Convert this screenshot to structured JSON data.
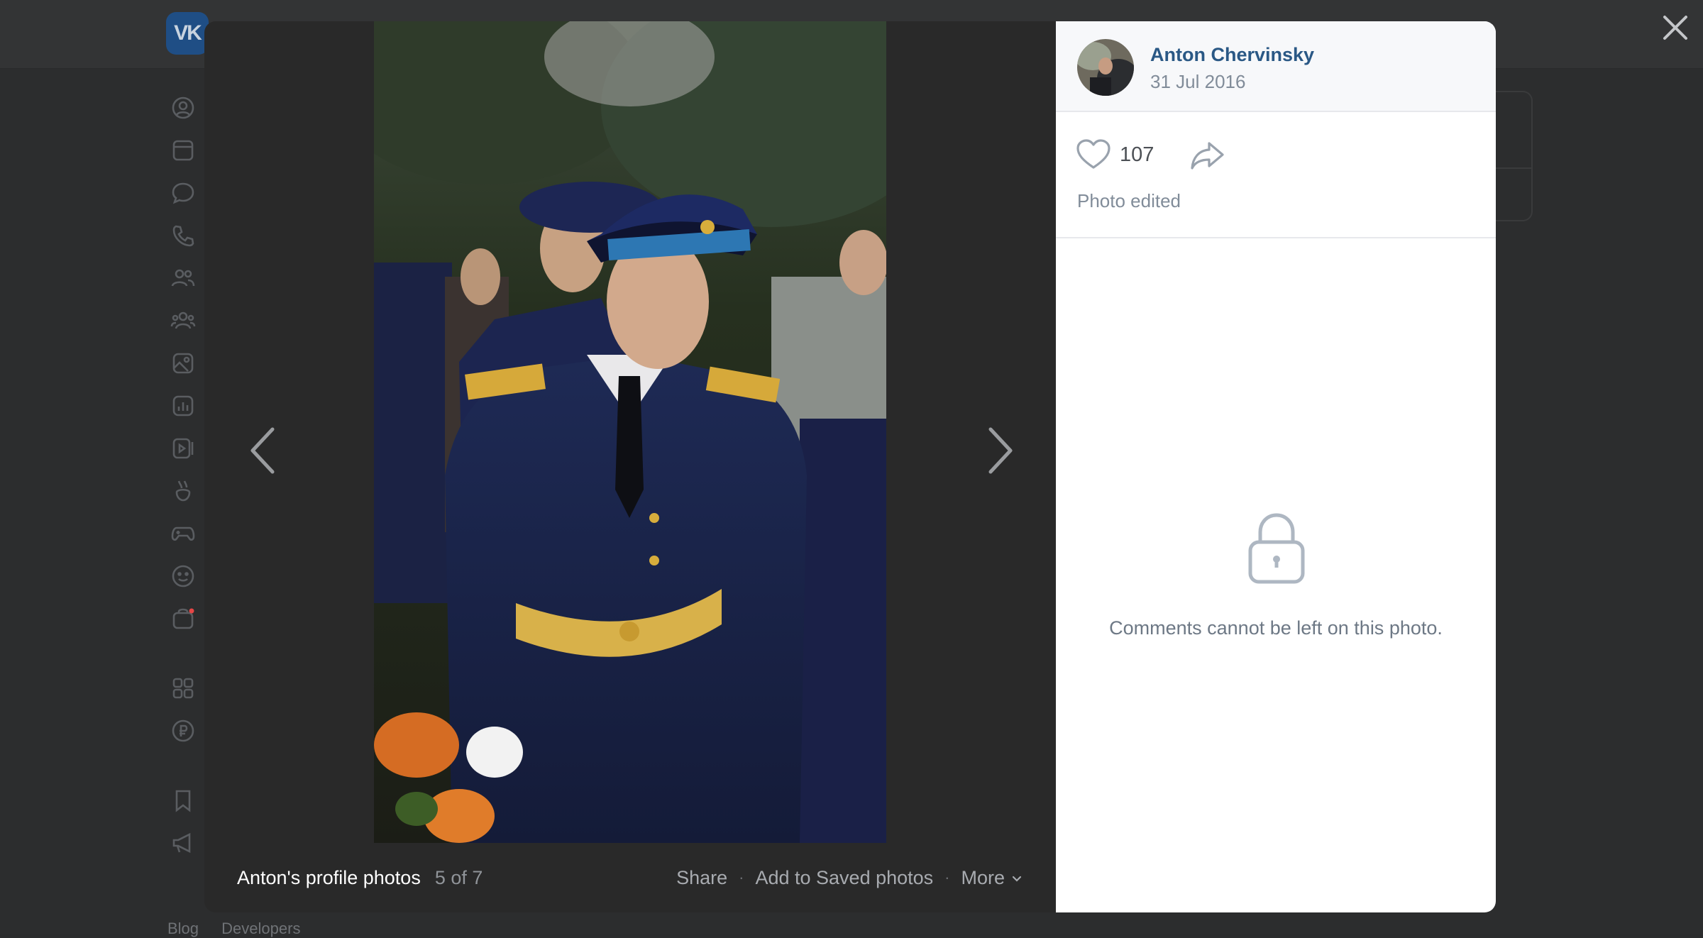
{
  "background": {
    "footer_links": [
      "Blog",
      "Developers"
    ],
    "sidebar_icons": [
      "profile-icon",
      "news-icon",
      "messages-icon",
      "calls-icon",
      "friends-icon",
      "communities-icon",
      "photos-icon",
      "music-icon",
      "videos-icon",
      "clips-icon",
      "games-icon",
      "stickers-icon",
      "market-icon",
      "services-icon",
      "payments-icon",
      "bookmarks-icon",
      "ads-icon"
    ]
  },
  "viewer": {
    "album_title": "Anton's profile photos",
    "position": "5 of 7",
    "actions": {
      "share": "Share",
      "save": "Add to Saved photos",
      "more": "More"
    }
  },
  "panel": {
    "author_name": "Anton Chervinsky",
    "date": "31 Jul 2016",
    "likes": "107",
    "photo_note": "Photo edited",
    "comments_notice": "Comments cannot be left on this photo."
  },
  "colors": {
    "link": "#2a5885",
    "muted": "#818c99",
    "overlay": "#2b2c2d"
  }
}
